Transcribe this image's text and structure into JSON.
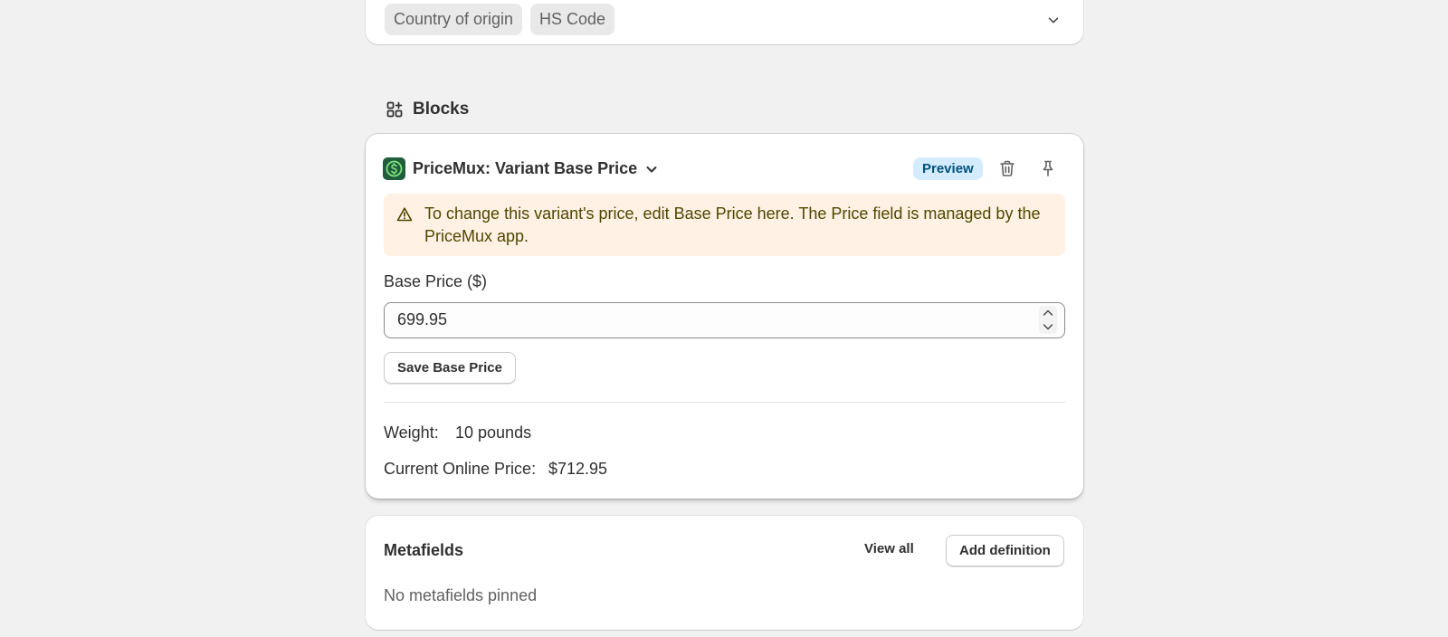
{
  "top_card": {
    "chips": [
      "Country of origin",
      "HS Code"
    ]
  },
  "blocks": {
    "title": "Blocks"
  },
  "block": {
    "title": "PriceMux: Variant Base Price",
    "badge": "Preview",
    "banner_text": "To change this variant's price, edit Base Price here. The Price field is managed by the PriceMux app.",
    "base_price_label": "Base Price ($)",
    "base_price_value": "699.95",
    "save_label": "Save Base Price",
    "weight_label": "Weight:",
    "weight_value": "10 pounds",
    "online_price_label": "Current Online Price:",
    "online_price_value": "$712.95"
  },
  "metafields": {
    "title": "Metafields",
    "view_all": "View all",
    "add_definition": "Add definition",
    "empty_text": "No metafields pinned"
  },
  "icons": {
    "blocks": "blocks-icon",
    "app_logo": "dollar-circle-icon",
    "chevron": "chevron-down-icon",
    "trash": "trash-icon",
    "pin": "pin-icon",
    "warning": "warning-triangle-icon"
  },
  "colors": {
    "background": "#f1f1f1",
    "banner_bg": "#fff1e3",
    "banner_text": "#4f4700",
    "badge_bg": "#d5ebff",
    "badge_text": "#00527c",
    "app_logo_bg": "#1f5d3c",
    "app_logo_accent": "#7ee27e"
  }
}
